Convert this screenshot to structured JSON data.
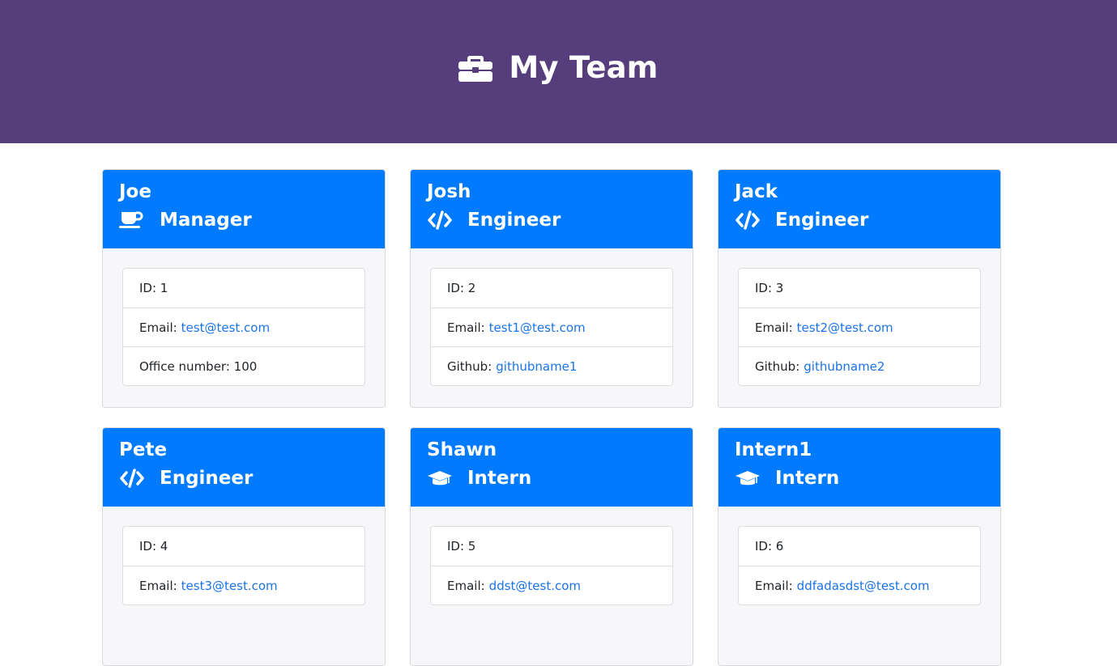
{
  "header": {
    "title": "My Team",
    "icon": "briefcase-icon",
    "background": "#563d7c"
  },
  "colors": {
    "card_header": "#007bff",
    "link": "#1a73e8"
  },
  "employees": [
    {
      "name": "Joe",
      "role": "Manager",
      "role_icon": "coffee-mug-icon",
      "id_label": "ID: 1",
      "email_label": "Email:",
      "email": "test@test.com",
      "extra_label": "Office number: 100",
      "extra_value": ""
    },
    {
      "name": "Josh",
      "role": "Engineer",
      "role_icon": "code-icon",
      "id_label": "ID: 2",
      "email_label": "Email:",
      "email": "test1@test.com",
      "extra_label": "Github:",
      "extra_value": "githubname1"
    },
    {
      "name": "Jack",
      "role": "Engineer",
      "role_icon": "code-icon",
      "id_label": "ID: 3",
      "email_label": "Email:",
      "email": "test2@test.com",
      "extra_label": "Github:",
      "extra_value": "githubname2"
    },
    {
      "name": "Pete",
      "role": "Engineer",
      "role_icon": "code-icon",
      "id_label": "ID: 4",
      "email_label": "Email:",
      "email": "test3@test.com"
    },
    {
      "name": "Shawn",
      "role": "Intern",
      "role_icon": "graduation-cap-icon",
      "id_label": "ID: 5",
      "email_label": "Email:",
      "email": "ddst@test.com"
    },
    {
      "name": "Intern1",
      "role": "Intern",
      "role_icon": "graduation-cap-icon",
      "id_label": "ID: 6",
      "email_label": "Email:",
      "email": "ddfadasdst@test.com"
    }
  ]
}
